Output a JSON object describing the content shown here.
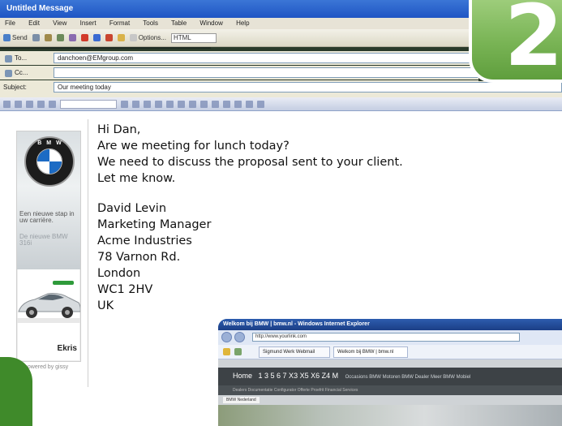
{
  "window": {
    "title": "Untitled Message"
  },
  "menu": [
    "File",
    "Edit",
    "View",
    "Insert",
    "Format",
    "Tools",
    "Table",
    "Window",
    "Help"
  ],
  "toolbar": {
    "send": "Send",
    "options": "Options...",
    "format": "HTML"
  },
  "headers": {
    "to_label": "To...",
    "to_value": "danchoen@EMgroup.com",
    "cc_label": "Cc...",
    "cc_value": "",
    "subject_label": "Subject:",
    "subject_value": "Our meeting today"
  },
  "badge": {
    "number": "2"
  },
  "banner": {
    "logo_letters": "BMW",
    "tagline_1": "Een nieuwe stap in uw carrière.",
    "tagline_2": "De nieuwe BMW 316i",
    "dealer": "Ekris",
    "powered_by": "powered by gissy"
  },
  "message": {
    "lines": [
      "Hi Dan,",
      "Are we meeting for lunch today?",
      "We need to discuss the proposal sent to your client.",
      "Let me know."
    ],
    "signature": [
      "David Levin",
      "Marketing Manager",
      "Acme Industries",
      "78 Varnon Rd.",
      "London",
      "WC1 2HV",
      "UK"
    ]
  },
  "browser": {
    "title": "Welkom bij BMW | bmw.nl - Windows Internet Explorer",
    "address": "http://www.yourlink.com",
    "tab1": "Sigmund Werk Webmail",
    "tab2": "Welkom bij BMW | bmw.nl",
    "nav_home": "Home",
    "nav_models": "1  3  5  6  7  X3  X5  X6  Z4  M",
    "nav_extra": "Occasions  BMW Motoren  BMW Dealer  Meer BMW  Mobiel",
    "subnav": "Dealers   Documentatie   Configurator   Offerte   Proefrit   Financial Services",
    "crumb": "BMW Nederland"
  }
}
